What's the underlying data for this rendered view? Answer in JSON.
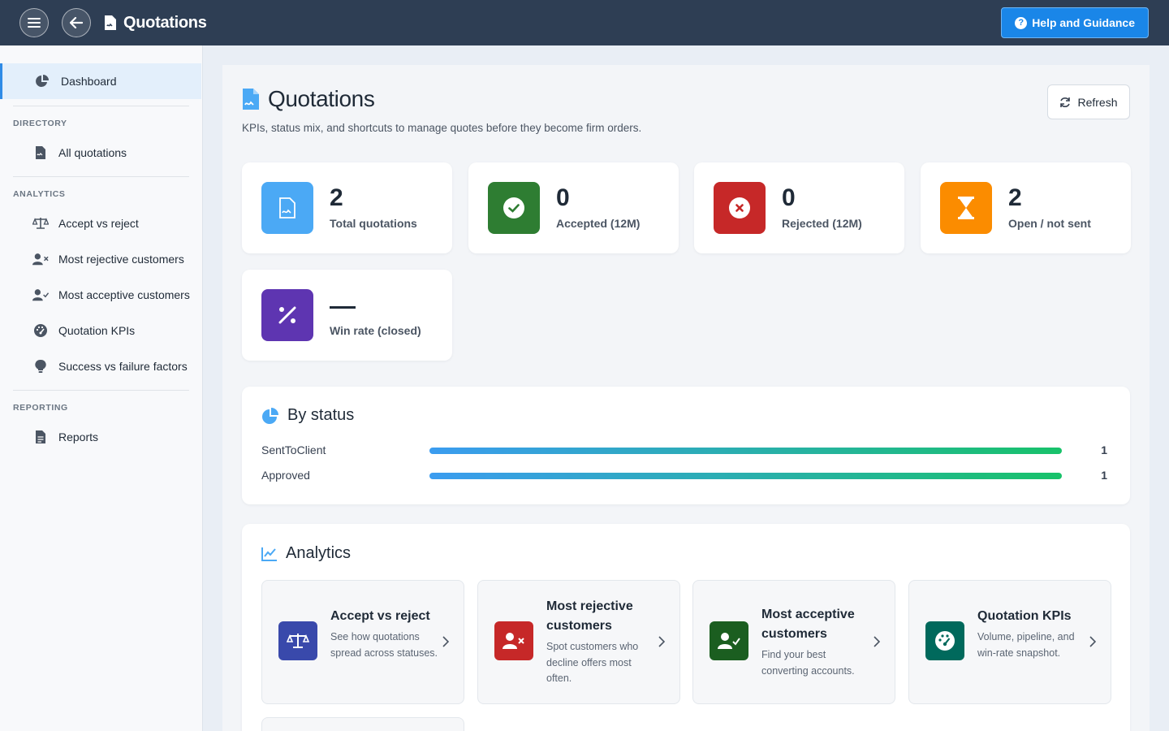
{
  "topbar": {
    "title": "Quotations",
    "help_label": "Help and Guidance"
  },
  "sidebar": {
    "dashboard": "Dashboard",
    "sections": [
      {
        "title": "DIRECTORY",
        "items": [
          {
            "label": "All quotations",
            "icon": "file-icon"
          }
        ]
      },
      {
        "title": "ANALYTICS",
        "items": [
          {
            "label": "Accept vs reject",
            "icon": "scale-icon"
          },
          {
            "label": "Most rejective customers",
            "icon": "user-x-icon"
          },
          {
            "label": "Most acceptive customers",
            "icon": "user-check-icon"
          },
          {
            "label": "Quotation KPIs",
            "icon": "gauge-icon"
          },
          {
            "label": "Success vs failure factors",
            "icon": "lightbulb-icon"
          }
        ]
      },
      {
        "title": "REPORTING",
        "items": [
          {
            "label": "Reports",
            "icon": "report-icon"
          }
        ]
      }
    ]
  },
  "main": {
    "title": "Quotations",
    "subtitle": "KPIs, status mix, and shortcuts to manage quotes before they become firm orders.",
    "refresh_label": "Refresh"
  },
  "kpis": [
    {
      "value": "2",
      "label": "Total quotations",
      "color": "#4ba9f5"
    },
    {
      "value": "0",
      "label": "Accepted (12M)",
      "color": "#2e7d32"
    },
    {
      "value": "0",
      "label": "Rejected (12M)",
      "color": "#c62828"
    },
    {
      "value": "2",
      "label": "Open / not sent",
      "color": "#fb8c00"
    },
    {
      "value": "",
      "label": "Win rate (closed)",
      "color": "#5e35b1"
    }
  ],
  "by_status": {
    "title": "By status",
    "rows": [
      {
        "name": "SentToClient",
        "count": "1"
      },
      {
        "name": "Approved",
        "count": "1"
      }
    ]
  },
  "analytics": {
    "title": "Analytics",
    "tiles": [
      {
        "title": "Accept vs reject",
        "desc": "See how quotations spread across statuses.",
        "color": "#3949ab",
        "icon": "scale-icon"
      },
      {
        "title": "Most rejective customers",
        "desc": "Spot customers who decline offers most often.",
        "color": "#c62828",
        "icon": "user-x-icon"
      },
      {
        "title": "Most acceptive customers",
        "desc": "Find your best converting accounts.",
        "color": "#1b5e20",
        "icon": "user-check-icon"
      },
      {
        "title": "Quotation KPIs",
        "desc": "Volume, pipeline, and win-rate snapshot.",
        "color": "#00695c",
        "icon": "gauge-icon"
      }
    ]
  }
}
